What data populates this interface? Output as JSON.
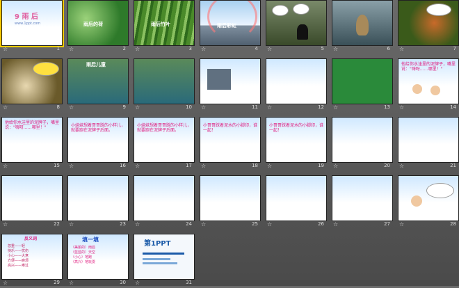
{
  "slides": [
    {
      "n": "1",
      "title": "9 雨 后",
      "sub": "www.1ppt.com"
    },
    {
      "n": "2",
      "title": "雨后的荷"
    },
    {
      "n": "3",
      "title": "雨后竹叶"
    },
    {
      "n": "4",
      "title": "雨后彩虹"
    },
    {
      "n": "5"
    },
    {
      "n": "6"
    },
    {
      "n": "7"
    },
    {
      "n": "8"
    },
    {
      "n": "9",
      "title": "雨后儿童"
    },
    {
      "n": "10"
    },
    {
      "n": "11"
    },
    {
      "n": "12"
    },
    {
      "n": "13"
    },
    {
      "n": "14",
      "title": "他给你水洼里的泥牌子，嘴里说：\"嗨呀……哪里！\""
    },
    {
      "n": "15",
      "title": "他给你水洼里的泥牌子，嘴里说：\"嗨呀……哪里！\""
    },
    {
      "n": "16",
      "title": "小妹妹想着哥哥踩的小样儿，就要跑在泥牌子后面。"
    },
    {
      "n": "17",
      "title": "小妹妹想着哥哥踩的小样儿，就要跑在泥牌子后面。"
    },
    {
      "n": "18",
      "title": "小哥哥踩着泥水的小脚印，谁一起！"
    },
    {
      "n": "19",
      "title": "小哥哥踩着泥水的小脚印，谁一起！"
    },
    {
      "n": "20"
    },
    {
      "n": "21"
    },
    {
      "n": "22"
    },
    {
      "n": "23"
    },
    {
      "n": "24"
    },
    {
      "n": "25"
    },
    {
      "n": "26"
    },
    {
      "n": "27"
    },
    {
      "n": "28"
    },
    {
      "n": "29",
      "title": "反义词",
      "lines": [
        "忽重——轻",
        "快乐——忧伤",
        "小心——大意",
        "方便——麻烦",
        "高兴——难过"
      ]
    },
    {
      "n": "30",
      "title": "填一填",
      "lines": [
        "（美丽的）雨后",
        "（蓝蓝的）天空",
        "（小心）地跑",
        "（高兴）地玩耍"
      ]
    },
    {
      "n": "31",
      "title": "第1PPT"
    }
  ]
}
